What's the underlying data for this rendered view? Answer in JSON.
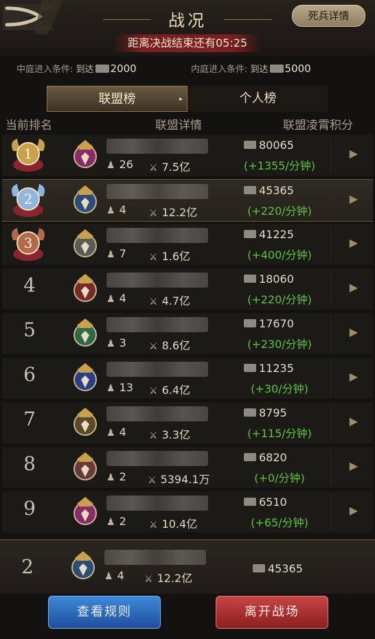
{
  "header": {
    "title": "战况",
    "detail_button": "死兵详情",
    "timer_label": "距离决战结束还有",
    "timer_value": "05:25"
  },
  "conditions": {
    "inner_court_label": "中庭进入条件:",
    "inner_court_reach": "到达",
    "inner_court_value": "2000",
    "inner_palace_label": "内庭进入条件:",
    "inner_palace_reach": "到达",
    "inner_palace_value": "5000"
  },
  "tabs": {
    "alliance": "联盟榜",
    "personal": "个人榜",
    "active": "alliance"
  },
  "columns": {
    "rank": "当前排名",
    "detail": "联盟详情",
    "score": "联盟凌霄积分"
  },
  "rows": [
    {
      "rank": "1",
      "members": "26",
      "power": "7.5亿",
      "score": "80065",
      "rate": "(+1355/分钟)"
    },
    {
      "rank": "2",
      "members": "4",
      "power": "12.2亿",
      "score": "45365",
      "rate": "(+220/分钟)"
    },
    {
      "rank": "3",
      "members": "7",
      "power": "1.6亿",
      "score": "41225",
      "rate": "(+400/分钟)"
    },
    {
      "rank": "4",
      "members": "4",
      "power": "4.7亿",
      "score": "18060",
      "rate": "(+220/分钟)"
    },
    {
      "rank": "5",
      "members": "3",
      "power": "8.6亿",
      "score": "17670",
      "rate": "(+230/分钟)"
    },
    {
      "rank": "6",
      "members": "13",
      "power": "6.4亿",
      "score": "11235",
      "rate": "(+30/分钟)"
    },
    {
      "rank": "7",
      "members": "4",
      "power": "3.3亿",
      "score": "8795",
      "rate": "(+115/分钟)"
    },
    {
      "rank": "8",
      "members": "2",
      "power": "5394.1万",
      "score": "6820",
      "rate": "(+0/分钟)"
    },
    {
      "rank": "9",
      "members": "2",
      "power": "10.4亿",
      "score": "6510",
      "rate": "(+65/分钟)"
    }
  ],
  "my_alliance": {
    "rank": "2",
    "members": "4",
    "power": "12.2亿",
    "score": "45365"
  },
  "buttons": {
    "rules": "查看规则",
    "leave": "离开战场"
  },
  "colors": {
    "rate_green": "#5cc33b",
    "gold_badge": "#c9a14a",
    "silver_badge": "#8fb6e0",
    "bronze_badge": "#b36a4a"
  }
}
